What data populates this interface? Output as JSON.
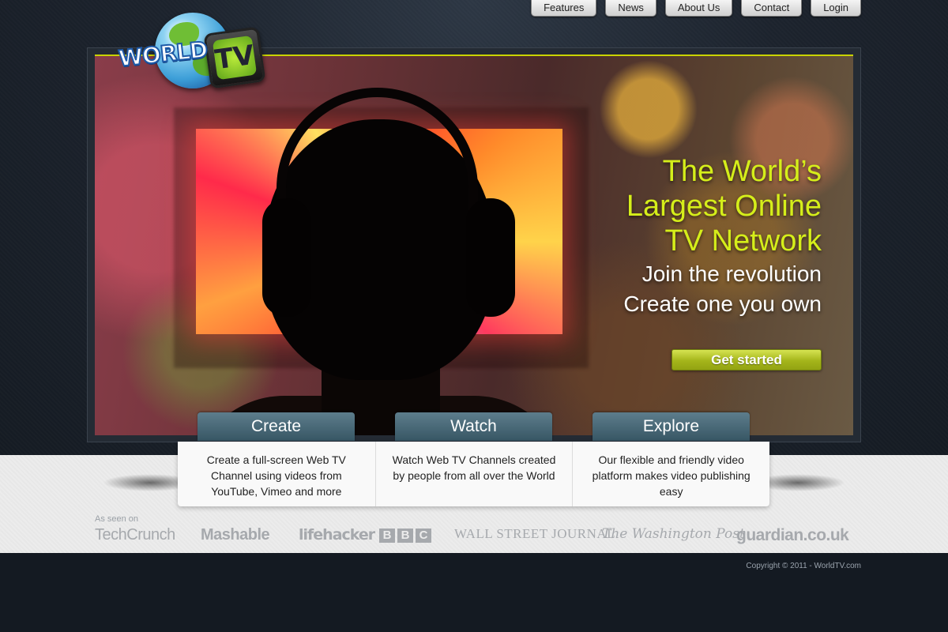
{
  "nav": {
    "items": [
      "Features",
      "News",
      "About Us",
      "Contact",
      "Login"
    ]
  },
  "logo": {
    "word": "WORLD",
    "tv": "TV"
  },
  "hero": {
    "headline_line1": "The World’s",
    "headline_line2": "Largest Online",
    "headline_line3": "TV Network",
    "subline1": "Join the revolution",
    "subline2": "Create one you own",
    "cta_label": "Get started"
  },
  "tabs": [
    "Create",
    "Watch",
    "Explore"
  ],
  "features": [
    "Create a full-screen Web TV Channel using videos from YouTube, Vimeo and more",
    "Watch Web TV Channels created by people from all over the World",
    "Our flexible and friendly video platform makes video publishing easy"
  ],
  "press": {
    "label": "As seen on",
    "outlets": {
      "techcrunch": "TechCrunch",
      "mashable": "Mashable",
      "lifehacker": "lifehacker",
      "bbc": [
        "B",
        "B",
        "C"
      ],
      "wsj": "WALL STREET JOURNAL",
      "wapo": "The Washington Post",
      "guardian": "guardian.co.uk"
    }
  },
  "footer": {
    "copyright": "Copyright © 2011 - WorldTV.com"
  },
  "colors": {
    "accent": "#d5ee1a",
    "cta": "#a4b51a",
    "tab": "#4a6a78",
    "background": "#141a22"
  }
}
